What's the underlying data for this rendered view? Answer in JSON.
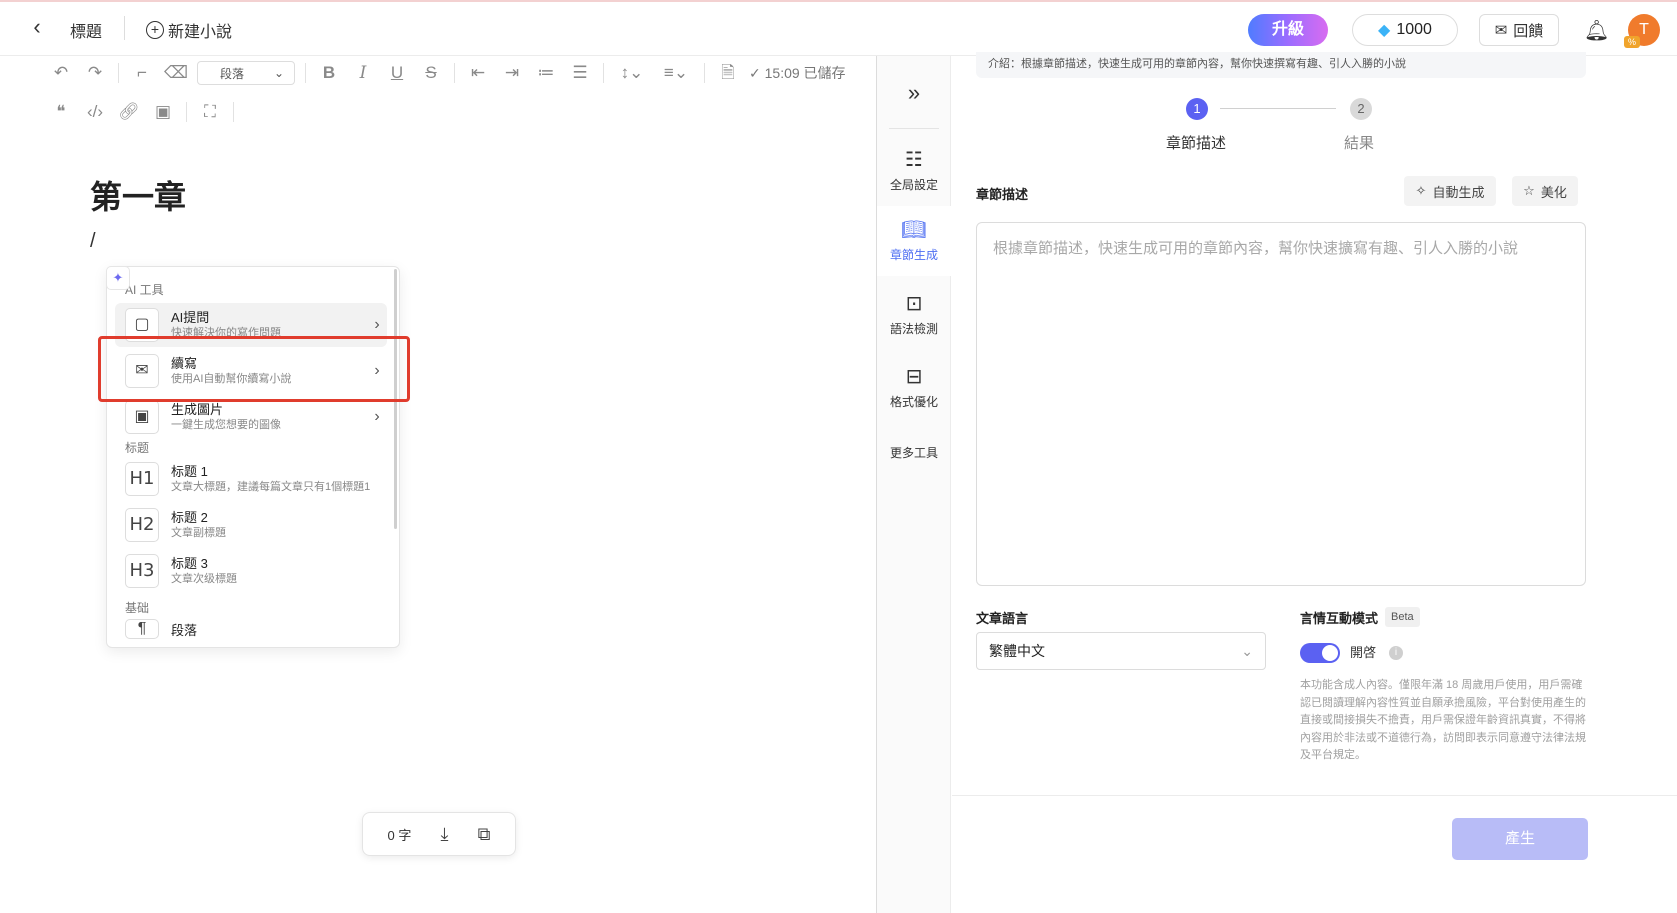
{
  "header": {
    "back_icon": "chevron-left-icon",
    "title": "標題",
    "new_novel_label": "新建小說",
    "upgrade_label": "升級",
    "credits": "1000",
    "feedback_label": "回饋",
    "avatar_letter": "T"
  },
  "toolbar": {
    "paragraph_select": "段落",
    "saved_status": "15:09 已儲存"
  },
  "editor": {
    "chapter_title": "第一章",
    "cursor_text": "/"
  },
  "slash_menu": {
    "sections": {
      "ai": "AI 工具",
      "heading": "标题",
      "basic": "基础"
    },
    "items": [
      {
        "title": "AI提問",
        "desc": "快速解決你的寫作問題"
      },
      {
        "title": "續寫",
        "desc": "使用AI自動幫你續寫小說"
      },
      {
        "title": "生成圖片",
        "desc": "一鍵生成您想要的圖像"
      },
      {
        "icon_text": "H1",
        "title": "标题 1",
        "desc": "文章大標題，建議每篇文章只有1個標題1"
      },
      {
        "icon_text": "H2",
        "title": "标题 2",
        "desc": "文章副標題"
      },
      {
        "icon_text": "H3",
        "title": "标题 3",
        "desc": "文章次级標題"
      },
      {
        "title": "段落"
      }
    ]
  },
  "word_count": "0 字",
  "rail": {
    "items": [
      {
        "label": "全局設定",
        "icon": "sliders-icon"
      },
      {
        "label": "章節生成",
        "icon": "book-icon"
      },
      {
        "label": "語法檢測",
        "icon": "grammar-check-icon"
      },
      {
        "label": "格式優化",
        "icon": "format-icon"
      },
      {
        "label": "更多工具"
      }
    ]
  },
  "panel": {
    "intro": "介紹：根據章節描述，快速生成可用的章節內容，幫你快速撰寫有趣、引人入勝的小說",
    "steps": [
      {
        "num": "1",
        "label": "章節描述"
      },
      {
        "num": "2",
        "label": "結果"
      }
    ],
    "desc_label": "章節描述",
    "auto_generate_label": "自動生成",
    "beautify_label": "美化",
    "desc_placeholder": "根據章節描述，快速生成可用的章節內容，幫你快速擴寫有趣、引人入勝的小說",
    "language_label": "文章語言",
    "language_value": "繁體中文",
    "romance_label": "言情互動模式",
    "beta_label": "Beta",
    "toggle_label": "開啓",
    "toggle_on": true,
    "disclaimer": "本功能含成人內容。僅限年滿 18 周歲用戶使用，用戶需確認已閱讀理解內容性質並自願承擔風險，平台對使用產生的直接或間接損失不擔責，用戶需保證年齡資訊真實，不得將內容用於非法或不道德行為，訪問即表示同意遵守法律法規及平台規定。",
    "generate_label": "產生"
  },
  "colors": {
    "accent": "#5b61f2",
    "highlight": "#e03c2d",
    "generate_disabled": "#b8bcf7"
  }
}
